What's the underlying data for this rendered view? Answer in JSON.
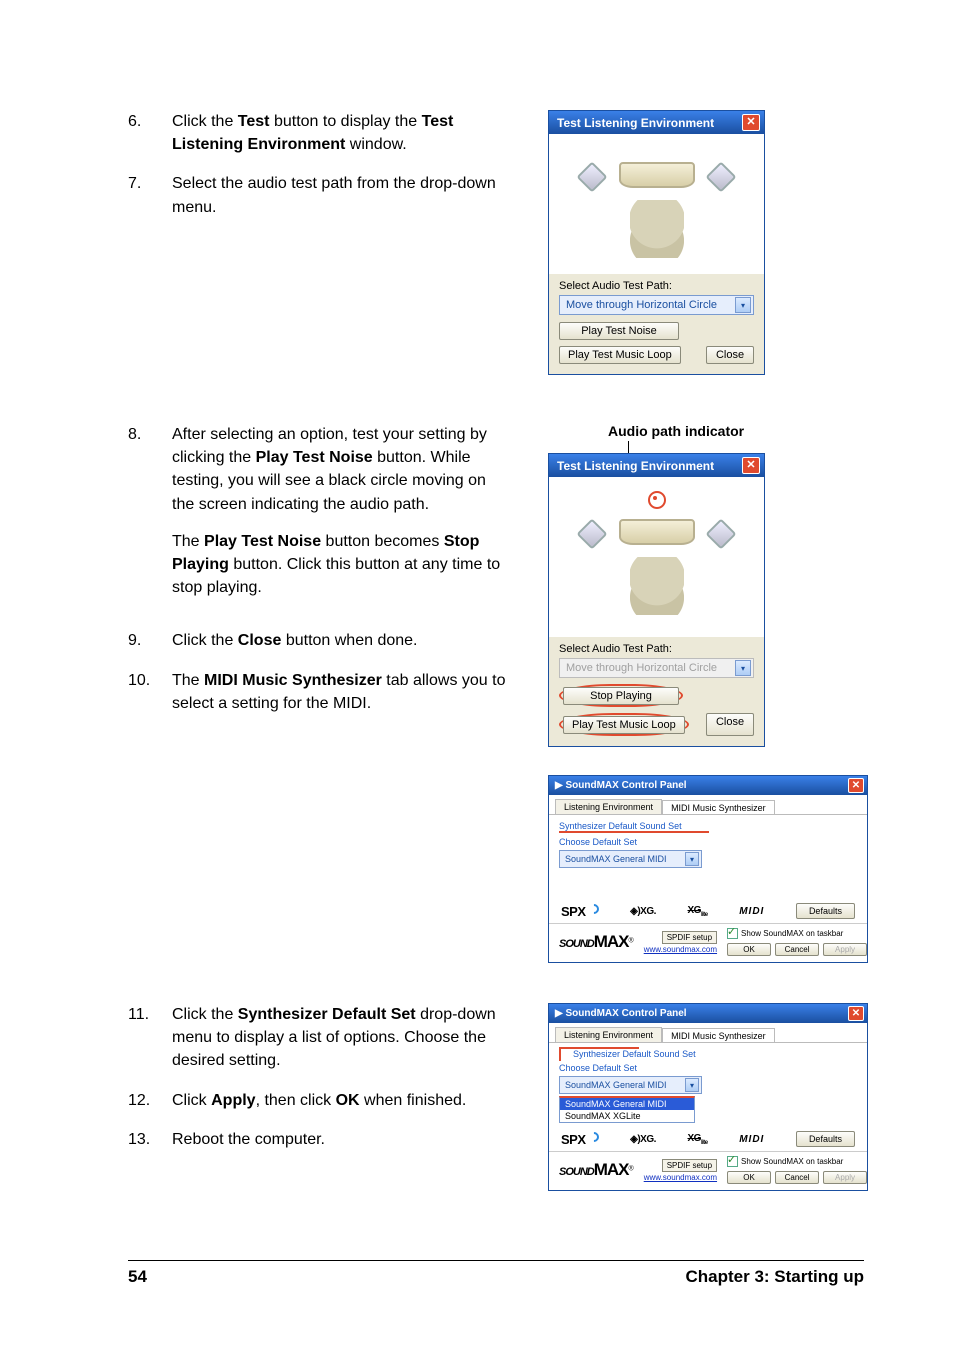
{
  "steps": {
    "s6": {
      "num": "6.",
      "txt": [
        "Click the ",
        "Test",
        " button to display the ",
        "Test Listening Environment",
        " window."
      ]
    },
    "s7": {
      "num": "7.",
      "txt": "Select the audio test path from the drop-down menu."
    },
    "s8": {
      "num": "8.",
      "p1": [
        "After selecting an option, test your setting by clicking the ",
        "Play Test Noise",
        " button. While testing, you will see a black circle moving on the screen indicating the audio path."
      ],
      "p2": [
        "The ",
        "Play Test Noise",
        " button becomes ",
        "Stop Playing",
        " button. Click this button at any time to stop playing."
      ]
    },
    "s9": {
      "num": "9.",
      "txt": [
        "Click the ",
        "Close",
        " button when done."
      ]
    },
    "s10": {
      "num": "10.",
      "txt": [
        "The ",
        "MIDI Music Synthesizer",
        " tab allows you to select a setting for the MIDI."
      ]
    },
    "s11": {
      "num": "11.",
      "txt": [
        "Click the ",
        "Synthesizer Default Set",
        " drop-down menu to display a list of options. Choose the desired setting."
      ]
    },
    "s12": {
      "num": "12.",
      "txt": [
        "Click ",
        "Apply",
        ", then click ",
        "OK",
        " when finished."
      ]
    },
    "s13": {
      "num": "13.",
      "txt": "Reboot the computer."
    }
  },
  "callout": {
    "audio_path": "Audio path indicator"
  },
  "tle": {
    "title": "Test Listening Environment",
    "close_glyph": "✕",
    "select_label": "Select Audio Test Path:",
    "select_option": "Move through Horizontal Circle",
    "btn_play_noise": "Play Test Noise",
    "btn_stop": "Stop Playing",
    "btn_loop": "Play Test Music Loop",
    "btn_close": "Close",
    "dd_glyph": "▾"
  },
  "smax": {
    "title": "SoundMAX Control Panel",
    "close_glyph": "✕",
    "tab1": "Listening Environment",
    "tab2": "MIDI Music Synthesizer",
    "sds_title": "Synthesizer Default Sound Set",
    "choose_label": "Choose Default Set",
    "select_val": "SoundMAX General MIDI",
    "dd_glyph": "▾",
    "list_opt2": "SoundMAX XGLite",
    "logo_spx": "SPX",
    "logo_xg": "◈)XG.",
    "logo_xglite": "XGlite",
    "logo_midi": "MIDI",
    "btn_defaults": "Defaults",
    "spdif": "SPDIF setup",
    "url": "www.soundmax.com",
    "chk": "Show SoundMAX on taskbar",
    "btn_ok": "OK",
    "btn_cancel": "Cancel",
    "btn_apply": "Apply",
    "brand_thin": "SOUND",
    "brand_max": "MAX",
    "brand_r": "®"
  },
  "footer": {
    "page": "54",
    "chapter": "Chapter 3: Starting up"
  }
}
